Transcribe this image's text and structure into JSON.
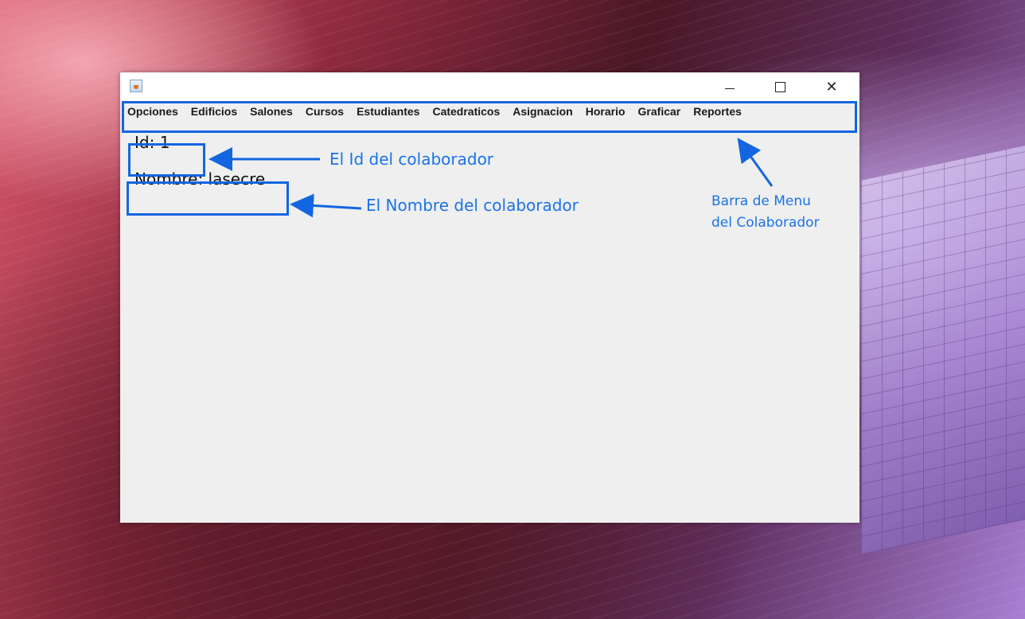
{
  "window": {
    "icon": "java-coffee-icon",
    "controls": {
      "minimize": "—",
      "close": "✕"
    }
  },
  "menu": {
    "items": [
      {
        "label": "Opciones"
      },
      {
        "label": "Edificios"
      },
      {
        "label": "Salones"
      },
      {
        "label": "Cursos"
      },
      {
        "label": "Estudiantes"
      },
      {
        "label": "Catedraticos"
      },
      {
        "label": "Asignacion"
      },
      {
        "label": "Horario"
      },
      {
        "label": "Graficar"
      },
      {
        "label": "Reportes"
      }
    ]
  },
  "content": {
    "id_label": "Id: 1",
    "name_label": "Nombre: lasecre"
  },
  "annotations": {
    "id_note": "El Id del colaborador",
    "name_note": "El Nombre del colaborador",
    "menu_note_line1": "Barra de Menu",
    "menu_note_line2": "del Colaborador",
    "color": "#1a73e8"
  }
}
